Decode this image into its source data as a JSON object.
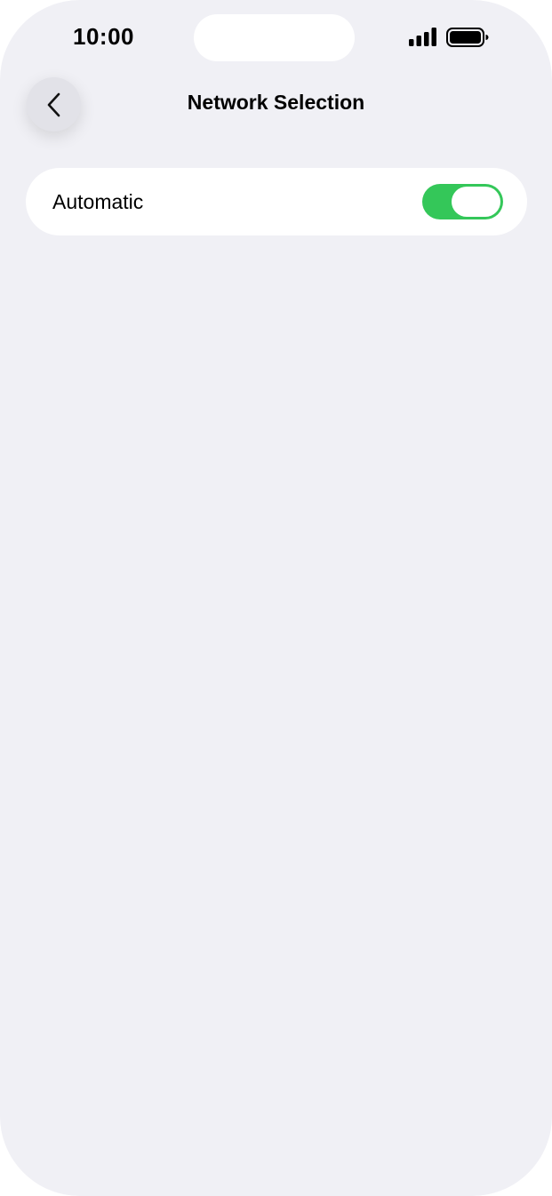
{
  "status_bar": {
    "time": "10:00",
    "signal_icon": "cellular-signal-icon",
    "battery_icon": "battery-full-icon"
  },
  "nav": {
    "title": "Network Selection",
    "back_icon": "chevron-left-icon"
  },
  "settings": {
    "automatic": {
      "label": "Automatic",
      "toggle_on": true
    }
  },
  "colors": {
    "background": "#f0f0f5",
    "toggle_on": "#34c759",
    "card": "#ffffff"
  }
}
